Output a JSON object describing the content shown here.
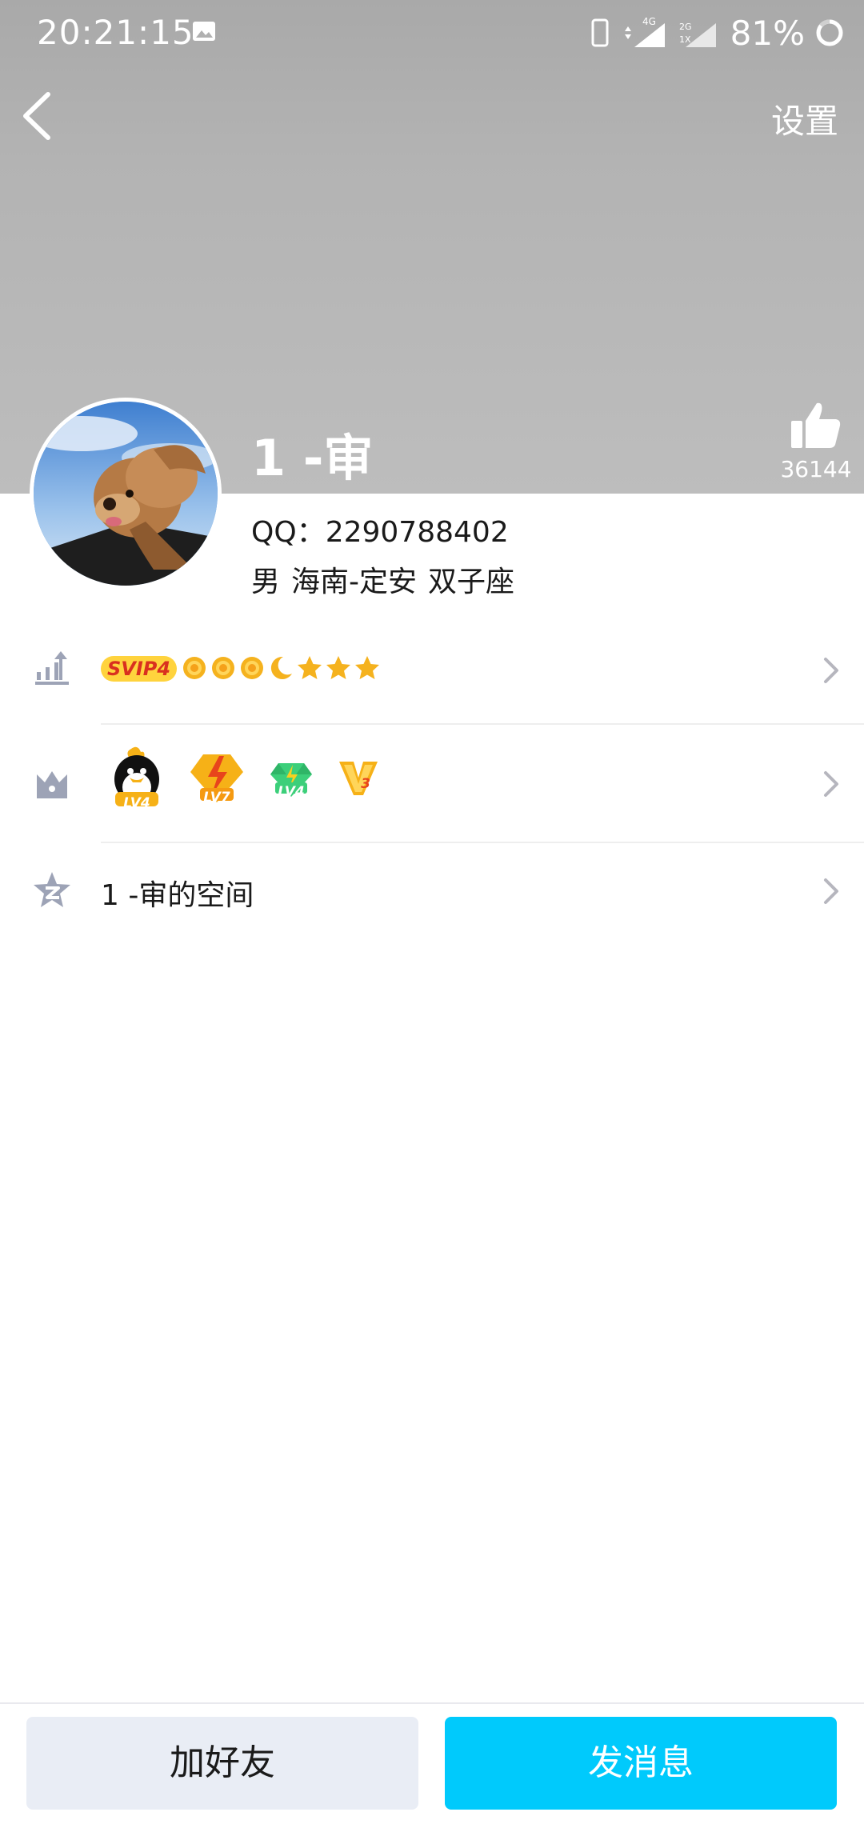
{
  "status_bar": {
    "time": "20:21:15",
    "network_1": "4G",
    "network_2_top": "2G",
    "network_2_bottom": "1X",
    "battery": "81%"
  },
  "nav": {
    "back_icon": "chevron-left-icon",
    "settings_label": "设置"
  },
  "profile": {
    "nickname": "1 -审",
    "likes": "36144",
    "qq_label": "QQ：",
    "qq_number": "2290788402",
    "gender": "男",
    "location": "海南-定安",
    "zodiac": "双子座"
  },
  "rows": {
    "vip": {
      "icon": "rank-chart-icon",
      "badge": "SVIP4",
      "level_icons": [
        "sun-icon",
        "sun-icon",
        "sun-icon",
        "moon-icon",
        "star-icon",
        "star-icon",
        "star-icon"
      ]
    },
    "badges": {
      "icon": "crown-icon",
      "items": [
        {
          "name": "qq-penguin-badge",
          "label": "LV4"
        },
        {
          "name": "lightning-badge",
          "label": "LV7"
        },
        {
          "name": "diamond-badge",
          "label": "LV4"
        },
        {
          "name": "v-badge",
          "label": "3"
        }
      ]
    },
    "space": {
      "icon": "zone-star-icon",
      "label": "1 -审的空间"
    }
  },
  "bottom": {
    "add_friend": "加好友",
    "send_message": "发消息"
  },
  "colors": {
    "banner": "#b3b3b3",
    "primary_button": "#00cafc",
    "secondary_button": "#e9edf5",
    "vip_badge": "#ffd33d"
  }
}
